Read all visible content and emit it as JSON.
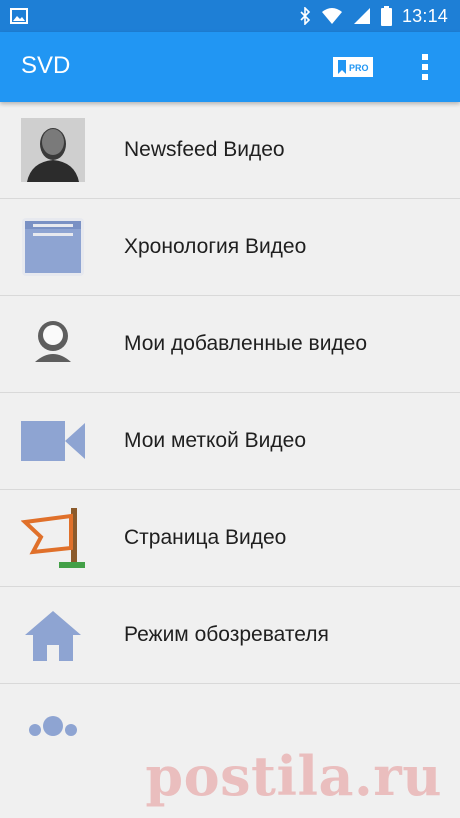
{
  "status_bar": {
    "time": "13:14",
    "icons": [
      "image-icon",
      "bluetooth-icon",
      "wifi-icon",
      "signal-icon",
      "battery-icon"
    ]
  },
  "app_bar": {
    "title": "SVD",
    "pro_badge": "PRO",
    "menu_icon": "more-vert-icon"
  },
  "list": {
    "items": [
      {
        "label": "Newsfeed Видео",
        "icon": "profile-photo"
      },
      {
        "label": "Хронология Видео",
        "icon": "timeline-icon"
      },
      {
        "label": "Мои добавленные видео",
        "icon": "user-icon"
      },
      {
        "label": "Мои меткой Видео",
        "icon": "video-camera-icon"
      },
      {
        "label": "Страница Видео",
        "icon": "flag-icon"
      },
      {
        "label": "Режим обозревателя",
        "icon": "home-icon"
      }
    ]
  },
  "watermark": "postila.ru",
  "colors": {
    "status_bar": "#1e7fd6",
    "app_bar": "#2196f3",
    "icon_blue": "#8ea4d2",
    "flag_orange": "#e0702a"
  }
}
